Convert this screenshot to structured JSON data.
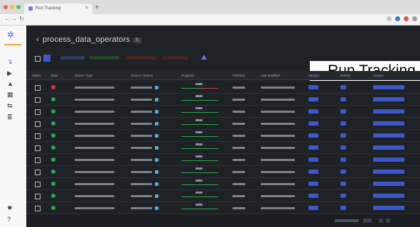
{
  "browser": {
    "tab_title": "Run Tracking",
    "tab_close": "×",
    "new_tab": "+",
    "nav_back": "←",
    "nav_forward": "→",
    "nav_reload": "↻"
  },
  "sidebar": {
    "items": [
      {
        "icon": "logo-icon",
        "glyph": "✲"
      },
      {
        "icon": "runs-icon",
        "glyph": "↴"
      },
      {
        "icon": "play-icon",
        "glyph": "▶"
      },
      {
        "icon": "warning-icon",
        "glyph": "▲"
      },
      {
        "icon": "table-icon",
        "glyph": "▦"
      },
      {
        "icon": "share-icon",
        "glyph": "⇆"
      },
      {
        "icon": "layers-icon",
        "glyph": "≣"
      },
      {
        "icon": "settings-icon",
        "glyph": "✹"
      },
      {
        "icon": "help-icon",
        "glyph": "?"
      }
    ]
  },
  "page": {
    "back_glyph": "‹",
    "title": "process_data_operators",
    "title_badge": "5",
    "overlay_label": "Run Tracking"
  },
  "colors": {
    "green": "#2ea84f",
    "red": "#d9363e",
    "blue": "#3e57c9",
    "teal": "#1cc6b7"
  },
  "table": {
    "headers": [
      "Select",
      "State",
      "Name / Type",
      "Service Version",
      "Progress",
      "Finished",
      "Last Modified",
      "Version",
      "Retries",
      "Actions"
    ],
    "rows": [
      {
        "state": "failed",
        "progress": 0.55
      },
      {
        "state": "success",
        "progress": 1.0
      },
      {
        "state": "success",
        "progress": 1.0
      },
      {
        "state": "success",
        "progress": 1.0
      },
      {
        "state": "success",
        "progress": 1.0
      },
      {
        "state": "success",
        "progress": 1.0
      },
      {
        "state": "success",
        "progress": 1.0
      },
      {
        "state": "success",
        "progress": 1.0
      },
      {
        "state": "success",
        "progress": 1.0
      },
      {
        "state": "success",
        "progress": 1.0
      },
      {
        "state": "success",
        "progress": 1.0
      }
    ]
  }
}
